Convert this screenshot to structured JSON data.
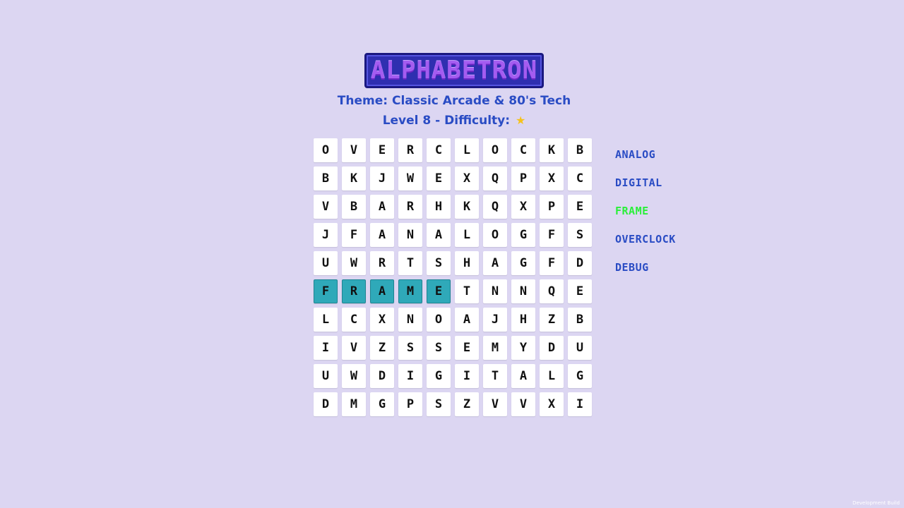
{
  "logo_text": "ALPHABETRON",
  "theme_line": "Theme: Classic Arcade & 80's Tech",
  "level_line": "Level 8 - Difficulty:",
  "difficulty_stars": "★",
  "grid": [
    [
      "O",
      "V",
      "E",
      "R",
      "C",
      "L",
      "O",
      "C",
      "K",
      "B"
    ],
    [
      "B",
      "K",
      "J",
      "W",
      "E",
      "X",
      "Q",
      "P",
      "X",
      "C"
    ],
    [
      "V",
      "B",
      "A",
      "R",
      "H",
      "K",
      "Q",
      "X",
      "P",
      "E"
    ],
    [
      "J",
      "F",
      "A",
      "N",
      "A",
      "L",
      "O",
      "G",
      "F",
      "S"
    ],
    [
      "U",
      "W",
      "R",
      "T",
      "S",
      "H",
      "A",
      "G",
      "F",
      "D"
    ],
    [
      "F",
      "R",
      "A",
      "M",
      "E",
      "T",
      "N",
      "N",
      "Q",
      "E"
    ],
    [
      "L",
      "C",
      "X",
      "N",
      "O",
      "A",
      "J",
      "H",
      "Z",
      "B"
    ],
    [
      "I",
      "V",
      "Z",
      "S",
      "S",
      "E",
      "M",
      "Y",
      "D",
      "U"
    ],
    [
      "U",
      "W",
      "D",
      "I",
      "G",
      "I",
      "T",
      "A",
      "L",
      "G"
    ],
    [
      "D",
      "M",
      "G",
      "P",
      "S",
      "Z",
      "V",
      "V",
      "X",
      "I"
    ]
  ],
  "highlighted_cells": [
    [
      5,
      0
    ],
    [
      5,
      1
    ],
    [
      5,
      2
    ],
    [
      5,
      3
    ],
    [
      5,
      4
    ]
  ],
  "words": [
    {
      "text": "ANALOG",
      "found": false
    },
    {
      "text": "DIGITAL",
      "found": false
    },
    {
      "text": "FRAME",
      "found": true
    },
    {
      "text": "OVERCLOCK",
      "found": false
    },
    {
      "text": "DEBUG",
      "found": false
    }
  ],
  "footer_note": "Development Build",
  "colors": {
    "background": "#dcd6f2",
    "text_blue": "#2a4cc4",
    "found_word": "#2aef3a",
    "highlight_cell": "#2fa9b9"
  }
}
